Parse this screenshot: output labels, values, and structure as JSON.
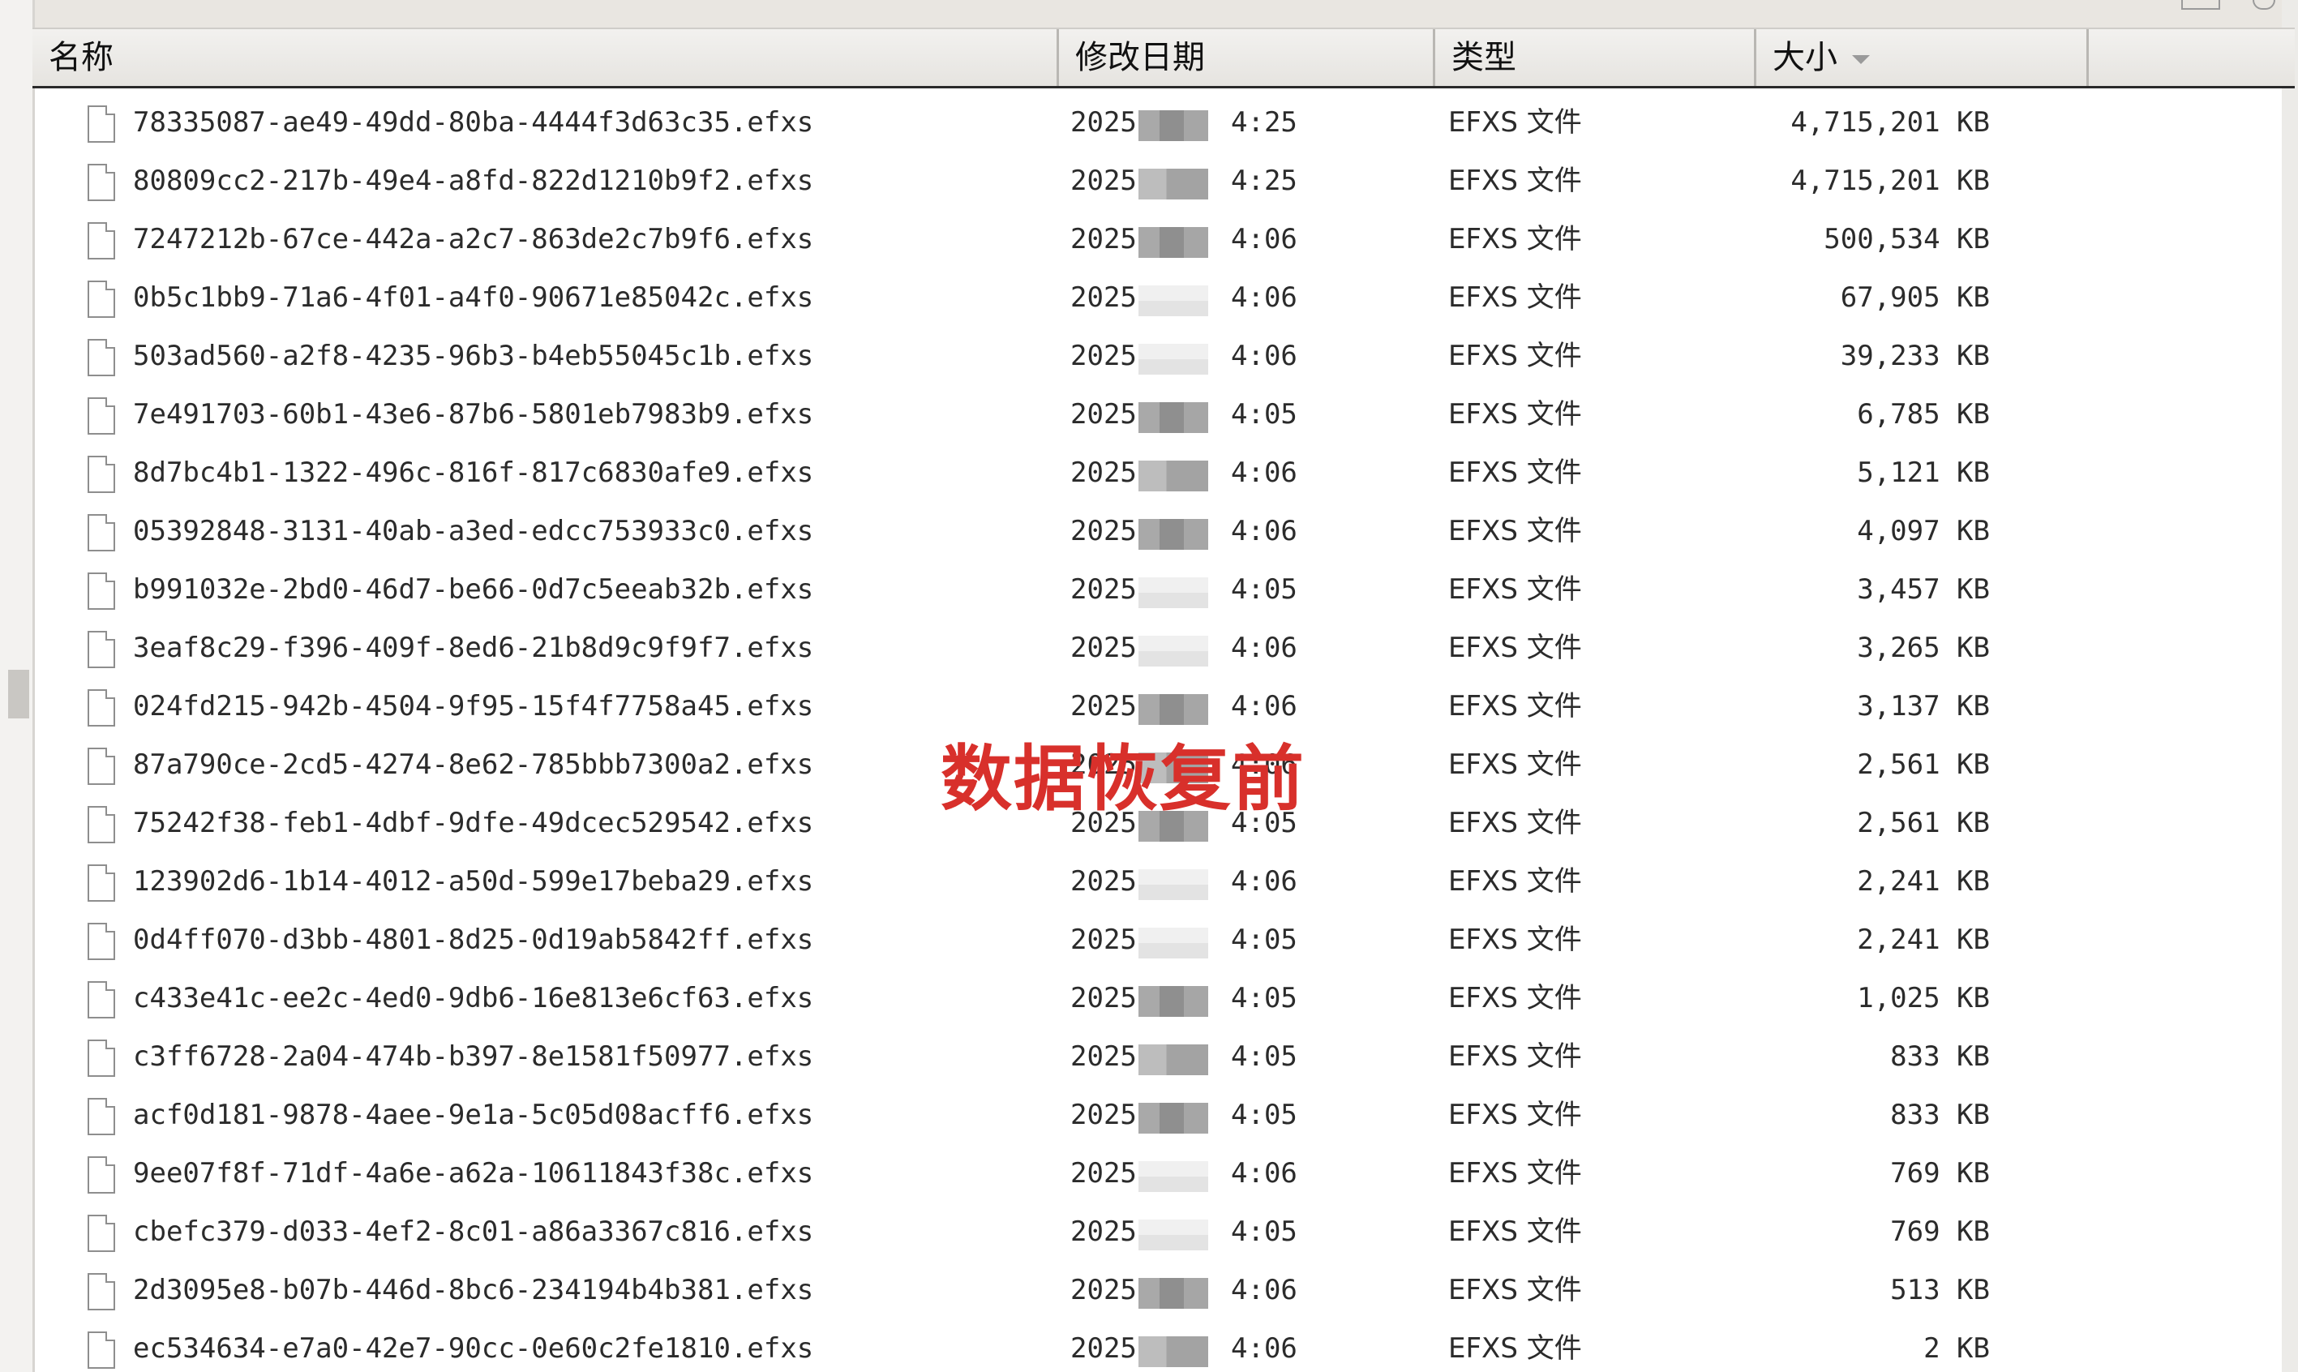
{
  "columns": {
    "name": "名称",
    "modified": "修改日期",
    "type": "类型",
    "size": "大小"
  },
  "watermark": "数据恢复前",
  "rows": [
    {
      "name": "78335087-ae49-49dd-80ba-4444f3d63c35.efxs",
      "year": "2025",
      "time": "4:25",
      "type": "EFXS 文件",
      "size": "4,715,201 KB",
      "blur": "dark"
    },
    {
      "name": "80809cc2-217b-49e4-a8fd-822d1210b9f2.efxs",
      "year": "2025",
      "time": "4:25",
      "type": "EFXS 文件",
      "size": "4,715,201 KB",
      "blur": "mid"
    },
    {
      "name": "7247212b-67ce-442a-a2c7-863de2c7b9f6.efxs",
      "year": "2025",
      "time": "4:06",
      "type": "EFXS 文件",
      "size": "500,534 KB",
      "blur": "dark"
    },
    {
      "name": "0b5c1bb9-71a6-4f01-a4f0-90671e85042c.efxs",
      "year": "2025",
      "time": "4:06",
      "type": "EFXS 文件",
      "size": "67,905 KB",
      "blur": "light"
    },
    {
      "name": "503ad560-a2f8-4235-96b3-b4eb55045c1b.efxs",
      "year": "2025",
      "time": "4:06",
      "type": "EFXS 文件",
      "size": "39,233 KB",
      "blur": "light"
    },
    {
      "name": "7e491703-60b1-43e6-87b6-5801eb7983b9.efxs",
      "year": "2025",
      "time": "4:05",
      "type": "EFXS 文件",
      "size": "6,785 KB",
      "blur": "dark"
    },
    {
      "name": "8d7bc4b1-1322-496c-816f-817c6830afe9.efxs",
      "year": "2025",
      "time": "4:06",
      "type": "EFXS 文件",
      "size": "5,121 KB",
      "blur": "mid"
    },
    {
      "name": "05392848-3131-40ab-a3ed-edcc753933c0.efxs",
      "year": "2025",
      "time": "4:06",
      "type": "EFXS 文件",
      "size": "4,097 KB",
      "blur": "dark"
    },
    {
      "name": "b991032e-2bd0-46d7-be66-0d7c5eeab32b.efxs",
      "year": "2025",
      "time": "4:05",
      "type": "EFXS 文件",
      "size": "3,457 KB",
      "blur": "light"
    },
    {
      "name": "3eaf8c29-f396-409f-8ed6-21b8d9c9f9f7.efxs",
      "year": "2025",
      "time": "4:06",
      "type": "EFXS 文件",
      "size": "3,265 KB",
      "blur": "light"
    },
    {
      "name": "024fd215-942b-4504-9f95-15f4f7758a45.efxs",
      "year": "2025",
      "time": "4:06",
      "type": "EFXS 文件",
      "size": "3,137 KB",
      "blur": "dark"
    },
    {
      "name": "87a790ce-2cd5-4274-8e62-785bbb7300a2.efxs",
      "year": "2025",
      "time": "4:06",
      "type": "EFXS 文件",
      "size": "2,561 KB",
      "blur": "mid"
    },
    {
      "name": "75242f38-feb1-4dbf-9dfe-49dcec529542.efxs",
      "year": "2025",
      "time": "4:05",
      "type": "EFXS 文件",
      "size": "2,561 KB",
      "blur": "dark"
    },
    {
      "name": "123902d6-1b14-4012-a50d-599e17beba29.efxs",
      "year": "2025",
      "time": "4:06",
      "type": "EFXS 文件",
      "size": "2,241 KB",
      "blur": "light"
    },
    {
      "name": "0d4ff070-d3bb-4801-8d25-0d19ab5842ff.efxs",
      "year": "2025",
      "time": "4:05",
      "type": "EFXS 文件",
      "size": "2,241 KB",
      "blur": "light"
    },
    {
      "name": "c433e41c-ee2c-4ed0-9db6-16e813e6cf63.efxs",
      "year": "2025",
      "time": "4:05",
      "type": "EFXS 文件",
      "size": "1,025 KB",
      "blur": "dark"
    },
    {
      "name": "c3ff6728-2a04-474b-b397-8e1581f50977.efxs",
      "year": "2025",
      "time": "4:05",
      "type": "EFXS 文件",
      "size": "833 KB",
      "blur": "mid"
    },
    {
      "name": "acf0d181-9878-4aee-9e1a-5c05d08acff6.efxs",
      "year": "2025",
      "time": "4:05",
      "type": "EFXS 文件",
      "size": "833 KB",
      "blur": "dark"
    },
    {
      "name": "9ee07f8f-71df-4a6e-a62a-10611843f38c.efxs",
      "year": "2025",
      "time": "4:06",
      "type": "EFXS 文件",
      "size": "769 KB",
      "blur": "light"
    },
    {
      "name": "cbefc379-d033-4ef2-8c01-a86a3367c816.efxs",
      "year": "2025",
      "time": "4:05",
      "type": "EFXS 文件",
      "size": "769 KB",
      "blur": "light"
    },
    {
      "name": "2d3095e8-b07b-446d-8bc6-234194b4b381.efxs",
      "year": "2025",
      "time": "4:06",
      "type": "EFXS 文件",
      "size": "513 KB",
      "blur": "dark"
    },
    {
      "name": "ec534634-e7a0-42e7-90cc-0e60c2fe1810.efxs",
      "year": "2025",
      "time": "4:06",
      "type": "EFXS 文件",
      "size": "2 KB",
      "blur": "mid"
    }
  ]
}
